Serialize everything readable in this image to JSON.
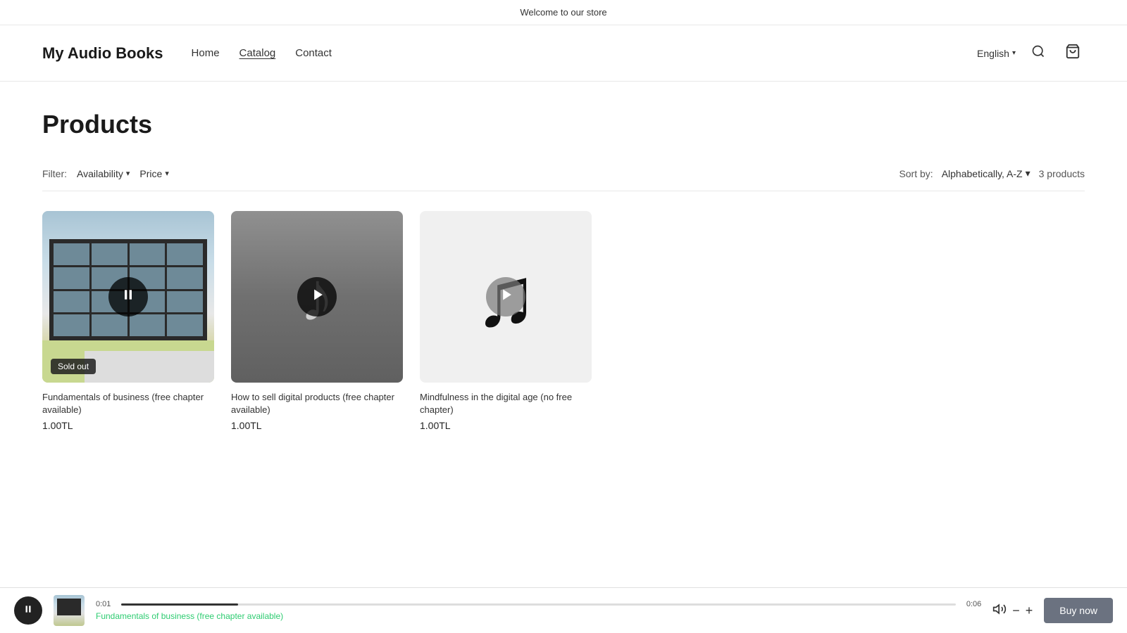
{
  "banner": {
    "text": "Welcome to our store"
  },
  "header": {
    "site_title": "My Audio Books",
    "nav": [
      {
        "label": "Home",
        "active": false
      },
      {
        "label": "Catalog",
        "active": true
      },
      {
        "label": "Contact",
        "active": false
      }
    ],
    "language": "English",
    "language_chevron": "▾"
  },
  "page": {
    "title": "Products"
  },
  "filter_bar": {
    "filter_label": "Filter:",
    "availability_label": "Availability",
    "price_label": "Price",
    "sort_label": "Sort by:",
    "sort_value": "Alphabetically, A-Z",
    "product_count": "3 products",
    "chevron": "▾"
  },
  "products": [
    {
      "id": "product-1",
      "name": "Fundamentals of business (free chapter available)",
      "price": "1.00TL",
      "sold_out": true,
      "sold_out_label": "Sold out",
      "image_type": "building",
      "playing": true
    },
    {
      "id": "product-2",
      "name": "How to sell digital products (free chapter available)",
      "price": "1.00TL",
      "sold_out": false,
      "image_type": "music-gray",
      "playing": false
    },
    {
      "id": "product-3",
      "name": "Mindfulness in the digital age (no free chapter)",
      "price": "1.00TL",
      "sold_out": false,
      "image_type": "music-black",
      "playing": false
    }
  ],
  "player": {
    "time_start": "0:01",
    "time_end": "0:06",
    "title": "Fundamentals of business (free chapter available)",
    "buy_now_label": "Buy now",
    "progress_percent": 14
  },
  "icons": {
    "search": "🔍",
    "cart": "🛒",
    "pause": "⏸",
    "play": "▶",
    "volume": "🔊",
    "minus": "−",
    "plus": "+"
  }
}
